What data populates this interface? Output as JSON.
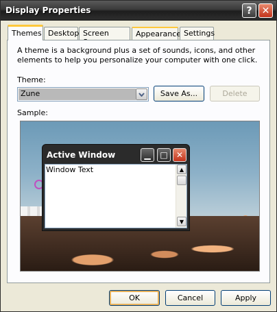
{
  "window": {
    "title": "Display Properties"
  },
  "tabs": [
    {
      "label": "Themes"
    },
    {
      "label": "Desktop"
    },
    {
      "label": "Screen Saver"
    },
    {
      "label": "Appearance"
    },
    {
      "label": "Settings"
    }
  ],
  "themes": {
    "description": "A theme is a background plus a set of sounds, icons, and other elements to help you personalize your computer with one click.",
    "theme_label": "Theme:",
    "theme_value": "Zune",
    "save_as_label": "Save As...",
    "delete_label": "Delete",
    "sample_label": "Sample:"
  },
  "preview": {
    "active_window_title": "Active Window",
    "window_text": "Window Text"
  },
  "footer": {
    "ok_label": "OK",
    "cancel_label": "Cancel",
    "apply_label": "Apply"
  }
}
